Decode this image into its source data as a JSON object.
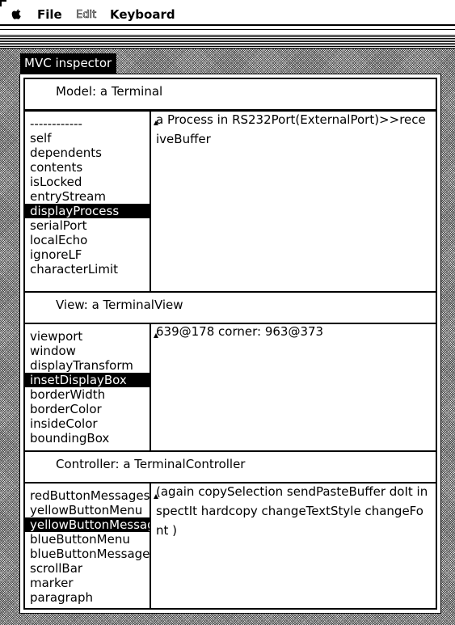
{
  "menubar": {
    "apple_icon": "apple-icon",
    "items": [
      {
        "label": "File",
        "enabled": true
      },
      {
        "label": "Edit",
        "enabled": false
      },
      {
        "label": "Keyboard",
        "enabled": true
      }
    ]
  },
  "window": {
    "title": "MVC inspector"
  },
  "model": {
    "header": "Model: a Terminal",
    "items": [
      "------------",
      "self",
      "dependents",
      "contents",
      "isLocked",
      "entryStream",
      "displayProcess",
      "serialPort",
      "localEcho",
      "ignoreLF",
      "characterLimit"
    ],
    "selected_index": 6,
    "value": "a Process in RS232Port(ExternalPort)>>receiveBuffer"
  },
  "view": {
    "header": "View: a TerminalView",
    "items": [
      "viewport",
      "window",
      "displayTransform",
      "insetDisplayBox",
      "borderWidth",
      "borderColor",
      "insideColor",
      "boundingBox"
    ],
    "selected_index": 3,
    "value": "639@178 corner: 963@373"
  },
  "controller": {
    "header": "Controller: a TerminalController",
    "items": [
      "redButtonMessages",
      "yellowButtonMenu",
      "yellowButtonMessages",
      "blueButtonMenu",
      "blueButtonMessages",
      "scrollBar",
      "marker",
      "paragraph"
    ],
    "selected_index": 2,
    "value": "(again copySelection sendPasteBuffer doIt inspectIt hardcopy changeTextStyle changeFont )"
  }
}
